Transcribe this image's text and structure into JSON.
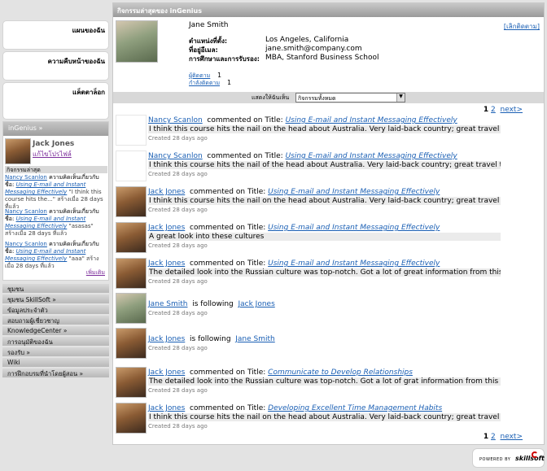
{
  "left_boxes": [
    "แผนของฉัน",
    "ความคืบหน้าของฉัน",
    "แค็ตตาล็อก"
  ],
  "ingenius": {
    "title": "inGenius",
    "user_name": "Jack Jones",
    "upgrade_link": "แก้ไขโปรไฟล์",
    "recent_activity_label": "กิจกรรมล่าสุด",
    "items": [
      {
        "name": "Nancy Scanlon",
        "text": "ความคิดเห็นเกี่ยวกับชื่อ:",
        "course": "Using E-mail and Instant Messaging Effectively",
        "comment": "\"I think this course hits the...\" สร้างเมื่อ 28 days ที่แล้ว"
      },
      {
        "name": "Nancy Scanlon",
        "text": "ความคิดเห็นเกี่ยวกับชื่อ:",
        "course": "Using E-mail and Instant Messaging Effectively",
        "comment": "\"asasas\" สร้างเมื่อ 28 days ที่แล้ว"
      },
      {
        "name": "Nancy Scanlon",
        "text": "ความคิดเห็นเกี่ยวกับชื่อ:",
        "course": "Using E-mail and Instant Messaging Effectively",
        "comment": "\"aaa\" สร้างเมื่อ 28 days ที่แล้ว"
      }
    ],
    "more_link": "เพิ่มเติม"
  },
  "nav": [
    "ชุมชน",
    "ชุมชน SkillSoft",
    "ข้อมูลประจำตัว",
    "สอบถามผู้เชี่ยวชาญ",
    "KnowledgeCenter",
    "การอนุมัติของฉัน",
    "รองรับ",
    "Wiki",
    "การฝึกอบรมที่นำโดยผู้สอน"
  ],
  "main": {
    "title": "กิจกรรมล่าสุดของ inGenius",
    "profile": {
      "name": "Jane  Smith",
      "unfollow": "[เลิกติดตาม]",
      "fields": [
        {
          "label": "ตำแหน่งที่ตั้ง:",
          "value": "Los Angeles, California"
        },
        {
          "label": "ที่อยู่อีเมล:",
          "value": "jane.smith@company.com"
        },
        {
          "label": "การศึกษาและการรับรอง:",
          "value": "MBA, Stanford Business School"
        }
      ],
      "followers_label": "ผู้ติดตาม",
      "followers_count": "1",
      "following_label": "กำลังติดตาม",
      "following_count": "1"
    },
    "filter_label": "แสดงให้ฉันเห็น",
    "filter_value": "กิจกรรมทั้งหมด",
    "pagination": {
      "current": "1",
      "next_page": "2",
      "next": "next>"
    },
    "activities": [
      {
        "avatar": "empty",
        "name": "Nancy Scanlon",
        "action": "commented on Title:",
        "target": "Using E-mail and Instant Messaging Effectively",
        "comment": "I think this course hits the nail on the head about Australia. Very laid-back country; great travel tips.",
        "created": "Created 28 days ago"
      },
      {
        "avatar": "empty",
        "name": "Nancy Scanlon",
        "action": "commented on Title:",
        "target": "Using E-mail and Instant Messaging Effectively",
        "comment": "I think this course hits the nail of the head about Australia. Very laid-back country; great travel tips.",
        "created": "Created 28 days ago"
      },
      {
        "avatar": "jack",
        "name": "Jack Jones",
        "action": "commented on Title:",
        "target": "Using E-mail and Instant Messaging Effectively",
        "comment": "I think this course hits the nail on the head about Australia. Very laid-back country; great travel tips.",
        "created": "Created 28 days ago"
      },
      {
        "avatar": "jack",
        "name": "Jack Jones",
        "action": "commented on Title:",
        "target": "Using E-mail and Instant Messaging Effectively",
        "comment": "A great look into these cultures",
        "created": "Created 28 days ago"
      },
      {
        "avatar": "jack",
        "name": "Jack Jones",
        "action": "commented on Title:",
        "target": "Using E-mail and Instant Messaging Effectively",
        "comment": "The detailed look into the Russian culture was top-notch. Got a lot of great information from this course",
        "created": "Created 28 days ago"
      },
      {
        "avatar": "jane",
        "name": "Jane Smith",
        "action": "is following",
        "follow": "Jack Jones",
        "created": "Created 28 days ago"
      },
      {
        "avatar": "jack",
        "name": "Jack Jones",
        "action": "is following",
        "follow": "Jane Smith",
        "created": "Created 28 days ago"
      },
      {
        "avatar": "jack",
        "name": "Jack Jones",
        "action": "commented on Title:",
        "target": "Communicate to Develop Relationships",
        "comment": "The detailed look into the Russian culture was top-notch. Got a lot of grat information from this course.",
        "created": "Created 28 days ago"
      },
      {
        "avatar": "jack",
        "name": "Jack Jones",
        "action": "commented on Title:",
        "target": "Developing Excellent Time Management Habits",
        "comment": "I think this course hits the nail on the head about Australia. Very laid-back country; great travel tips.",
        "created": "Created 28 days ago"
      }
    ]
  },
  "footer": {
    "powered_by": "POWERED BY",
    "brand": "skillsoft"
  }
}
